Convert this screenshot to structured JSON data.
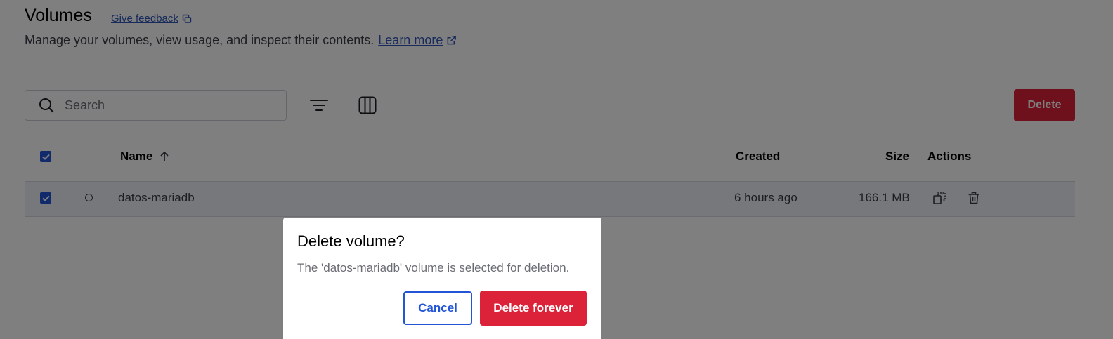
{
  "header": {
    "title": "Volumes",
    "feedback_link": "Give feedback",
    "subtitle": "Manage your volumes, view usage, and inspect their contents.",
    "learn_more": "Learn more"
  },
  "toolbar": {
    "search_placeholder": "Search",
    "delete_label": "Delete"
  },
  "table": {
    "columns": {
      "name": "Name",
      "created": "Created",
      "size": "Size",
      "actions": "Actions"
    },
    "sort": {
      "column": "Name",
      "direction": "ascending"
    },
    "rows": [
      {
        "name": "datos-mariadb",
        "created": "6 hours ago",
        "size": "166.1 MB",
        "selected": true
      }
    ]
  },
  "dialog": {
    "title": "Delete volume?",
    "body": "The 'datos-mariadb' volume is selected for deletion.",
    "cancel_label": "Cancel",
    "confirm_label": "Delete forever"
  },
  "colors": {
    "accent": "#2155d6",
    "danger": "#dc2238",
    "link": "#2f55b6",
    "overlay": "rgba(0,0,0,0.5)"
  },
  "icons": [
    "external-link-icon",
    "search-icon",
    "filter-icon",
    "columns-icon",
    "sort-up-arrow-icon",
    "checkmark-icon",
    "copy-icon",
    "trash-icon"
  ]
}
